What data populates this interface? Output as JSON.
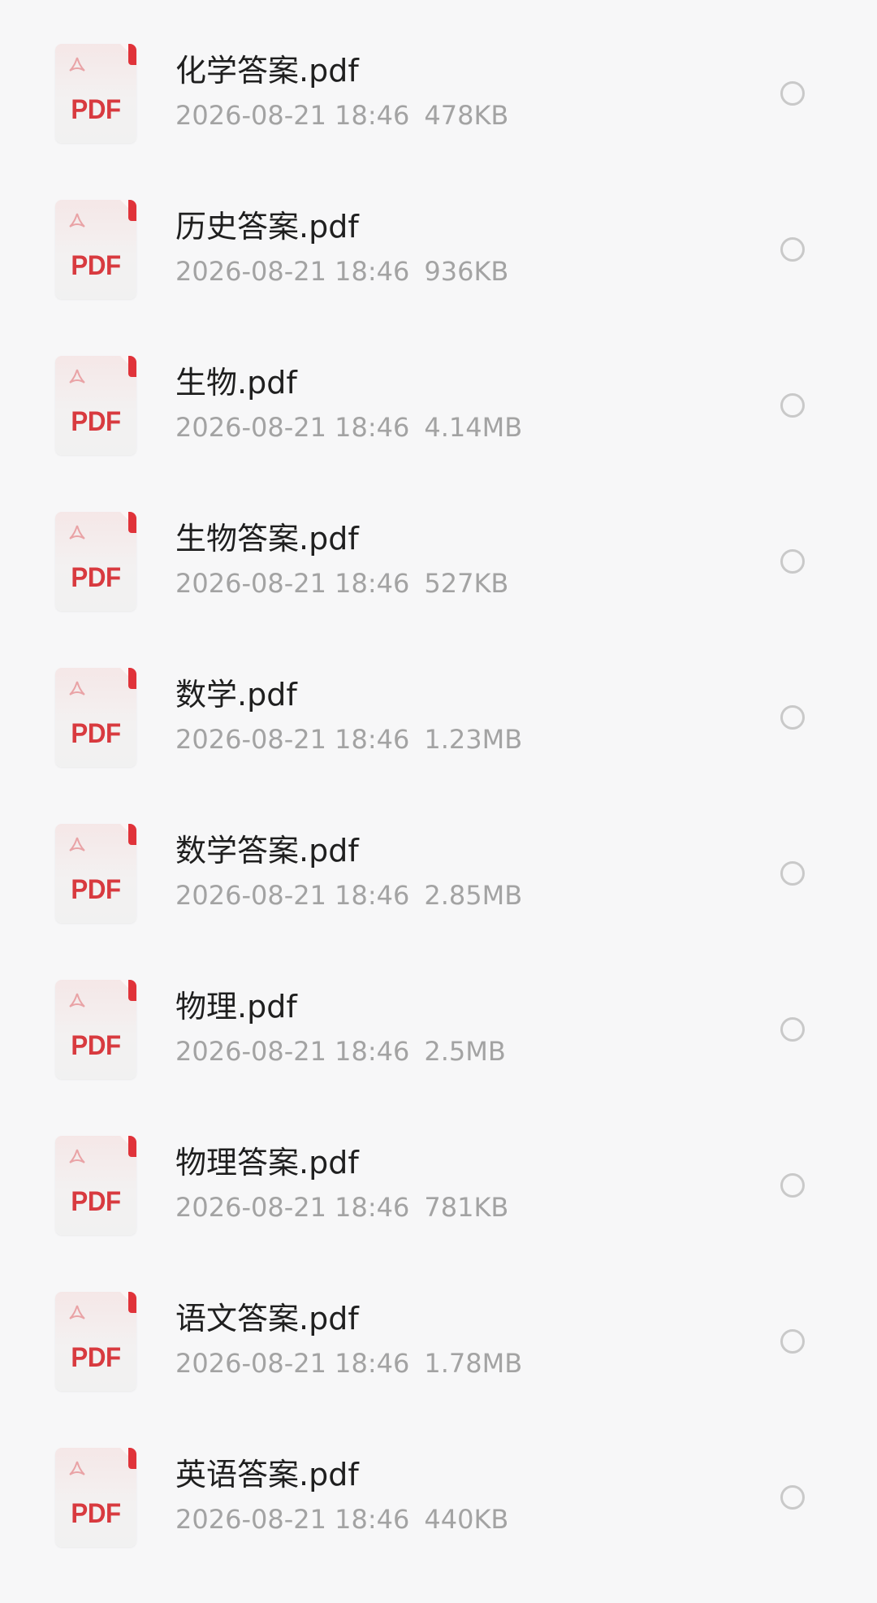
{
  "files": [
    {
      "name": "化学答案.pdf",
      "date": "2026-08-21 18:46",
      "size": "478KB",
      "icon": "pdf-file-icon",
      "icon_label": "PDF"
    },
    {
      "name": "历史答案.pdf",
      "date": "2026-08-21 18:46",
      "size": "936KB",
      "icon": "pdf-file-icon",
      "icon_label": "PDF"
    },
    {
      "name": "生物.pdf",
      "date": "2026-08-21 18:46",
      "size": "4.14MB",
      "icon": "pdf-file-icon",
      "icon_label": "PDF"
    },
    {
      "name": "生物答案.pdf",
      "date": "2026-08-21 18:46",
      "size": "527KB",
      "icon": "pdf-file-icon",
      "icon_label": "PDF"
    },
    {
      "name": "数学.pdf",
      "date": "2026-08-21 18:46",
      "size": "1.23MB",
      "icon": "pdf-file-icon",
      "icon_label": "PDF"
    },
    {
      "name": "数学答案.pdf",
      "date": "2026-08-21 18:46",
      "size": "2.85MB",
      "icon": "pdf-file-icon",
      "icon_label": "PDF"
    },
    {
      "name": "物理.pdf",
      "date": "2026-08-21 18:46",
      "size": "2.5MB",
      "icon": "pdf-file-icon",
      "icon_label": "PDF"
    },
    {
      "name": "物理答案.pdf",
      "date": "2026-08-21 18:46",
      "size": "781KB",
      "icon": "pdf-file-icon",
      "icon_label": "PDF"
    },
    {
      "name": "语文答案.pdf",
      "date": "2026-08-21 18:46",
      "size": "1.78MB",
      "icon": "pdf-file-icon",
      "icon_label": "PDF"
    },
    {
      "name": "英语答案.pdf",
      "date": "2026-08-21 18:46",
      "size": "440KB",
      "icon": "pdf-file-icon",
      "icon_label": "PDF"
    }
  ],
  "colors": {
    "background": "#f7f7f8",
    "pdf_red": "#d83a3f",
    "name_text": "#1f1f1f",
    "meta_text": "#a3a3a3",
    "radio_border": "#c9c9c9"
  }
}
